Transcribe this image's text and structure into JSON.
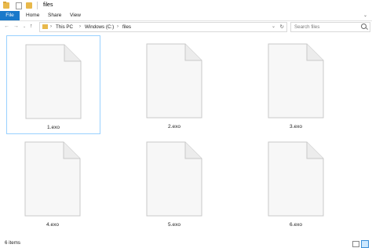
{
  "window": {
    "title": "files"
  },
  "ribbon": {
    "tabs": [
      "File",
      "Home",
      "Share",
      "View"
    ]
  },
  "navigation": {
    "back_icon": "arrow-left-icon",
    "forward_icon": "arrow-right-icon",
    "recent_icon": "chevron-down-icon",
    "up_icon": "arrow-up-icon"
  },
  "address": {
    "crumbs": [
      "This PC",
      "Windows (C:)",
      "files"
    ],
    "separator": "›"
  },
  "search": {
    "placeholder": "Search files"
  },
  "files": [
    {
      "name": "1.exo",
      "selected": true
    },
    {
      "name": "2.exo",
      "selected": false
    },
    {
      "name": "3.exo",
      "selected": false
    },
    {
      "name": "4.exo",
      "selected": false
    },
    {
      "name": "5.exo",
      "selected": false
    },
    {
      "name": "6.exo",
      "selected": false
    }
  ],
  "status": {
    "item_count": "6 items"
  },
  "colors": {
    "accent": "#1979ca",
    "selection_border": "#99d1ff",
    "folder": "#e8b84a"
  }
}
